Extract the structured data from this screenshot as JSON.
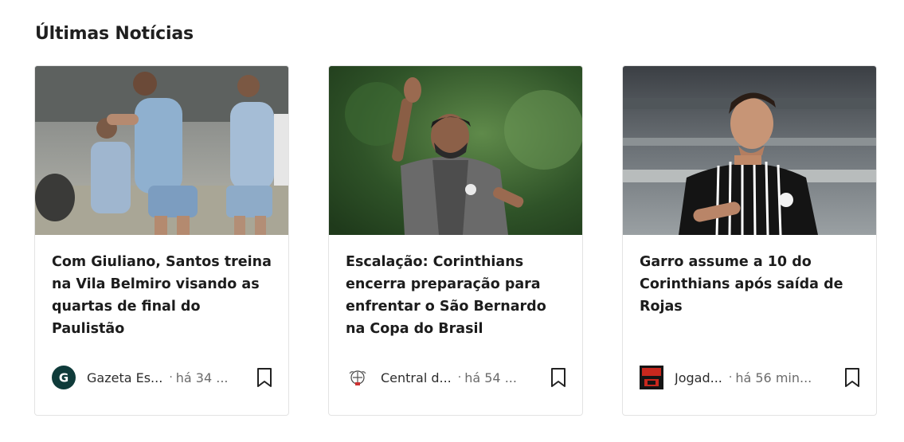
{
  "section": {
    "title": "Últimas Notícias"
  },
  "cards": [
    {
      "headline": "Com Giuliano, Santos treina na Vila Belmiro visando as quartas de final do Paulistão",
      "source": "Gazeta Es...",
      "time": "há 34 ...",
      "logo_letter": "G"
    },
    {
      "headline": "Escalação: Corinthians encerra preparação para enfrentar o São Bernardo na Copa do Brasil",
      "source": "Central d...",
      "time": "há 54 ..."
    },
    {
      "headline": "Garro assume a 10 do Corinthians após saída de Rojas",
      "source": "Jogad...",
      "time": "há 56 min...",
      "logo_text": "JOGADA 10"
    }
  ],
  "separator": "·",
  "colors": {
    "gazeta_logo": "#0f3b3a",
    "jogada_logo": "#c8281e"
  },
  "icons": [
    "bookmark-icon",
    "gazeta-logo-icon",
    "corinthians-logo-icon",
    "jogada10-logo-icon"
  ]
}
